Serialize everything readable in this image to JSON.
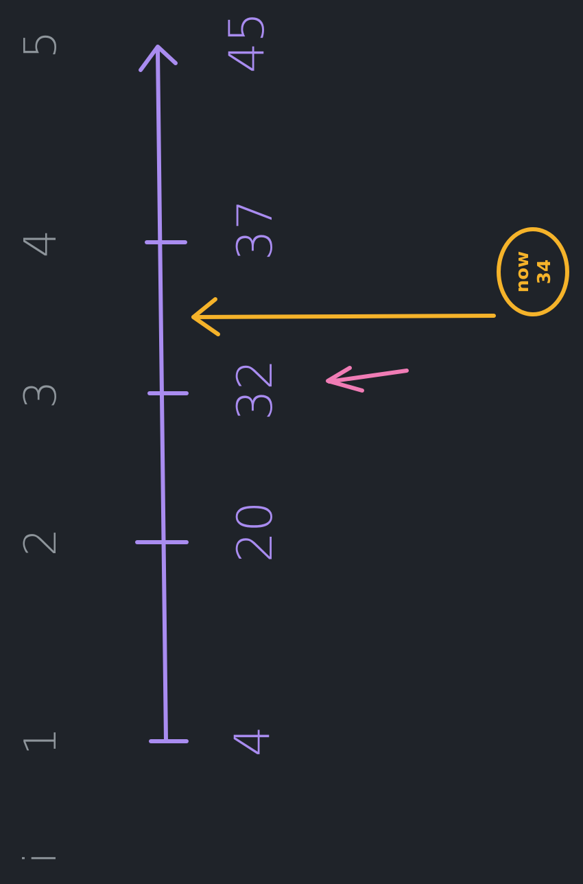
{
  "colors": {
    "background": "#1f2329",
    "index_labels": "#8e959b",
    "number_line": "#a98cf0",
    "current_marker": "#f5b32a",
    "small_arrow": "#f07cb5"
  },
  "index_labels": [
    "i",
    "1",
    "2",
    "3",
    "4",
    "5"
  ],
  "value_labels": [
    "4",
    "20",
    "32",
    "37",
    "45"
  ],
  "current": {
    "word": "now",
    "value": "34"
  },
  "icons": {
    "line_end": "arrow-head-icon",
    "pointer": "arrow-icon",
    "small_pointer": "arrow-icon"
  }
}
